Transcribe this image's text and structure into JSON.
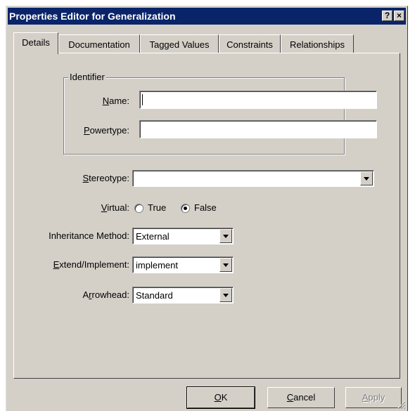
{
  "window": {
    "title": "Properties Editor for Generalization",
    "help_glyph": "?",
    "close_glyph": "×"
  },
  "tabs": [
    {
      "label": "Details",
      "active": true
    },
    {
      "label": "Documentation",
      "active": false
    },
    {
      "label": "Tagged Values",
      "active": false
    },
    {
      "label": "Constraints",
      "active": false
    },
    {
      "label": "Relationships",
      "active": false
    }
  ],
  "identifier": {
    "legend": "Identifier",
    "name_label": {
      "key": "N",
      "rest": "ame:"
    },
    "name_value": "",
    "powertype_label": {
      "key": "P",
      "rest": "owertype:"
    },
    "powertype_value": ""
  },
  "stereotype": {
    "label_key": "S",
    "label_rest": "tereotype:",
    "value": ""
  },
  "virtual": {
    "label_key": "V",
    "label_rest": "irtual:",
    "options": [
      {
        "label": "True",
        "checked": false
      },
      {
        "label": "False",
        "checked": true
      }
    ]
  },
  "inheritance": {
    "label": "Inheritance Method:",
    "value": "External"
  },
  "extend": {
    "label_key": "E",
    "label_rest": "xtend/Implement:",
    "value": "implement"
  },
  "arrowhead": {
    "label_pre": "A",
    "label_key": "r",
    "label_rest": "rowhead:",
    "value": "Standard"
  },
  "buttons": {
    "ok": {
      "key": "O",
      "rest": "K"
    },
    "cancel": {
      "key": "C",
      "rest": "ancel"
    },
    "apply": {
      "key": "A",
      "rest": "pply",
      "disabled": true
    }
  }
}
